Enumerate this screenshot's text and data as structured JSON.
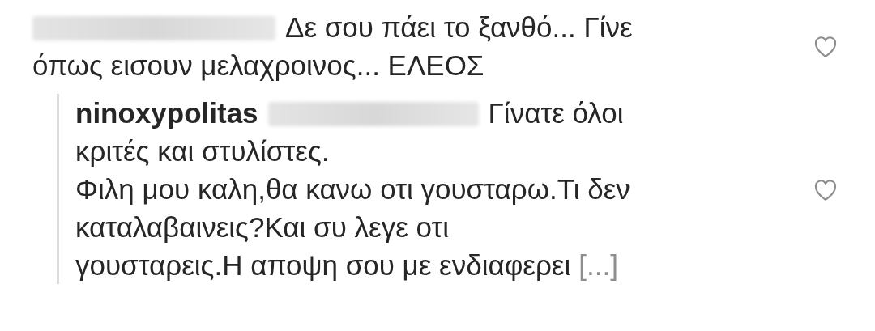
{
  "comments": [
    {
      "username_redacted": true,
      "lines": [
        "Δε σου πάει το ξανθό... Γίνε",
        "όπως εισουν μελαχροινος... ΕΛΕΟΣ"
      ],
      "liked": false,
      "replies": [
        {
          "username": "ninoxypolitas",
          "mention_redacted": true,
          "lines": [
            "Γίνατε όλοι",
            "κριτές και στυλίστες.",
            "Φιλη μου καλη,θα κανω οτι γουσταρω.Τι δεν",
            "καταλαβαινεις?Και συ λεγε οτι",
            "γουσταρεις.Η αποψη σου με ενδιαφερει"
          ],
          "more": "[...]",
          "liked": false
        }
      ]
    }
  ]
}
